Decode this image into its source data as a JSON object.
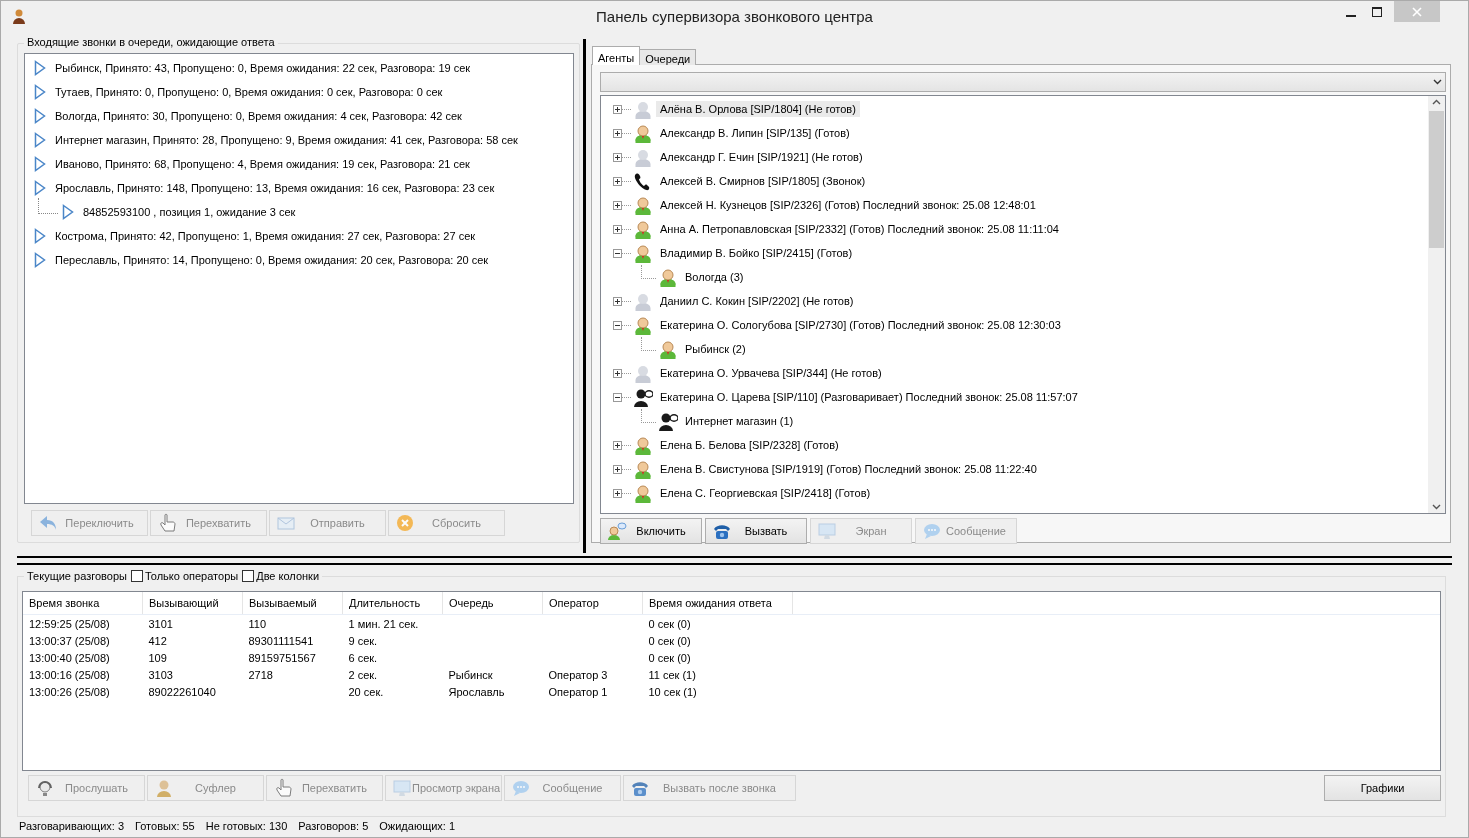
{
  "window": {
    "title": "Панель супервизора звонкового центра"
  },
  "queue_panel": {
    "title": "Входящие звонки в очереди, ожидающие ответа",
    "items": [
      {
        "text": "Рыбинск, Принято: 43, Пропущено: 0, Время ожидания: 22 сек, Разговора: 19 сек"
      },
      {
        "text": "Тутаев, Принято: 0, Пропущено: 0, Время ожидания: 0 сек, Разговора: 0 сек"
      },
      {
        "text": "Вологда, Принято: 30, Пропущено: 0, Время ожидания: 4 сек, Разговора: 42 сек"
      },
      {
        "text": "Интернет магазин, Принято: 28, Пропущено: 9, Время ожидания: 41 сек, Разговора: 58 сек"
      },
      {
        "text": "Иваново, Принято: 68, Пропущено: 4, Время ожидания: 19 сек, Разговора: 21 сек"
      },
      {
        "text": "Ярославль, Принято: 148, Пропущено: 13, Время ожидания: 16 сек, Разговора: 23 сек",
        "children": [
          {
            "text": "84852593100 , позиция 1, ожидание 3 сек"
          }
        ]
      },
      {
        "text": "Кострома, Принято: 42, Пропущено: 1, Время ожидания: 27 сек, Разговора: 27 сек"
      },
      {
        "text": "Переславль, Принято: 14, Пропущено: 0, Время ожидания: 20 сек, Разговора: 20 сек"
      }
    ],
    "buttons": [
      {
        "label": "Переключить",
        "disabled": true
      },
      {
        "label": "Перехватить",
        "disabled": true
      },
      {
        "label": "Отправить",
        "disabled": true
      },
      {
        "label": "Сбросить",
        "disabled": true
      }
    ]
  },
  "agents_panel": {
    "tabs": [
      {
        "label": "Агенты",
        "selected": true
      },
      {
        "label": "Очереди",
        "selected": false
      }
    ],
    "agents": [
      {
        "text": "Алёна В. Орлова [SIP/1804] (Не готов)",
        "kind": "idle",
        "expanded": false,
        "selected": true
      },
      {
        "text": "Александр В. Липин [SIP/135] (Готов)",
        "kind": "available",
        "expanded": false,
        "selected": false
      },
      {
        "text": "Александр Г. Ечин [SIP/1921] (Не готов)",
        "kind": "idle",
        "expanded": false,
        "selected": false
      },
      {
        "text": "Алексей В. Смирнов [SIP/1805] (Звонок)",
        "kind": "phone",
        "expanded": false,
        "selected": false
      },
      {
        "text": "Алексей Н. Кузнецов [SIP/2326] (Готов) Последний звонок: 25.08 12:48:01",
        "kind": "available",
        "expanded": false,
        "selected": false
      },
      {
        "text": "Анна А. Петропавловская [SIP/2332] (Готов) Последний звонок: 25.08 11:11:04",
        "kind": "available",
        "expanded": false,
        "selected": false
      },
      {
        "text": "Владимир В. Бойко [SIP/2415] (Готов)",
        "kind": "available",
        "expanded": true,
        "selected": false,
        "children": [
          {
            "text": "Вологда (3)",
            "kind": "available"
          }
        ]
      },
      {
        "text": "Даниил С. Кокин [SIP/2202] (Не готов)",
        "kind": "idle",
        "expanded": false,
        "selected": false
      },
      {
        "text": "Екатерина О. Сологубова [SIP/2730] (Готов) Последний звонок: 25.08 12:30:03",
        "kind": "available",
        "expanded": true,
        "selected": false,
        "children": [
          {
            "text": "Рыбинск (2)",
            "kind": "available"
          }
        ]
      },
      {
        "text": "Екатерина О. Урвачева [SIP/344] (Не готов)",
        "kind": "idle",
        "expanded": false,
        "selected": false
      },
      {
        "text": "Екатерина О. Царева [SIP/110] (Разговаривает) Последний звонок: 25.08 11:57:07",
        "kind": "speaking",
        "expanded": true,
        "selected": false,
        "children": [
          {
            "text": "Интернет магазин (1)",
            "kind": "speaking"
          }
        ]
      },
      {
        "text": "Елена Б. Белова [SIP/2328] (Готов)",
        "kind": "available",
        "expanded": false,
        "selected": false
      },
      {
        "text": "Елена В. Свистунова [SIP/1919] (Готов) Последний звонок: 25.08 11:22:40",
        "kind": "available",
        "expanded": false,
        "selected": false
      },
      {
        "text": "Елена С. Георгиевская [SIP/2418] (Готов)",
        "kind": "available",
        "expanded": false,
        "selected": false
      }
    ],
    "buttons": [
      {
        "label": "Включить",
        "disabled": false
      },
      {
        "label": "Вызвать",
        "disabled": false
      },
      {
        "label": "Экран",
        "disabled": true
      },
      {
        "label": "Сообщение",
        "disabled": true
      }
    ]
  },
  "calls_panel": {
    "title": "Текущие разговоры",
    "checkboxes": [
      {
        "label": "Только операторы",
        "checked": false
      },
      {
        "label": "Две колонки",
        "checked": false
      }
    ],
    "table": {
      "columns": [
        "Время звонка",
        "Вызывающий",
        "Вызываемый",
        "Длительность",
        "Очередь",
        "Оператор",
        "Время ожидания ответа"
      ],
      "rows": [
        [
          "12:59:25 (25/08)",
          "3101",
          "110",
          "1 мин. 21 сек.",
          "",
          "",
          "0 сек (0)"
        ],
        [
          "13:00:37 (25/08)",
          "412",
          "89301111541",
          "9 сек.",
          "",
          "",
          "0 сек (0)"
        ],
        [
          "13:00:40 (25/08)",
          "109",
          "89159751567",
          "6 сек.",
          "",
          "",
          "0 сек (0)"
        ],
        [
          "13:00:16 (25/08)",
          "3103",
          "2718",
          "2 сек.",
          "Рыбинск",
          "Оператор 3",
          "11 сек (1)"
        ],
        [
          "13:00:26 (25/08)",
          "89022261040",
          "",
          "20 сек.",
          "Ярославль",
          "Оператор 1",
          "10 сек (1)"
        ]
      ]
    },
    "buttons": [
      {
        "label": "Прослушать",
        "disabled": true
      },
      {
        "label": "Суфлер",
        "disabled": true
      },
      {
        "label": "Перехватить",
        "disabled": true
      },
      {
        "label": "Просмотр экрана",
        "disabled": true
      },
      {
        "label": "Сообщение",
        "disabled": true
      },
      {
        "label": "Вызвать после звонка",
        "disabled": true
      }
    ],
    "charts_button": {
      "label": "Графики",
      "disabled": false
    }
  },
  "status_bar": [
    "Разговаривающих: 3",
    "Готовых: 55",
    "Не готовых: 130",
    "Разговоров: 5",
    "Ожидающих: 1"
  ]
}
